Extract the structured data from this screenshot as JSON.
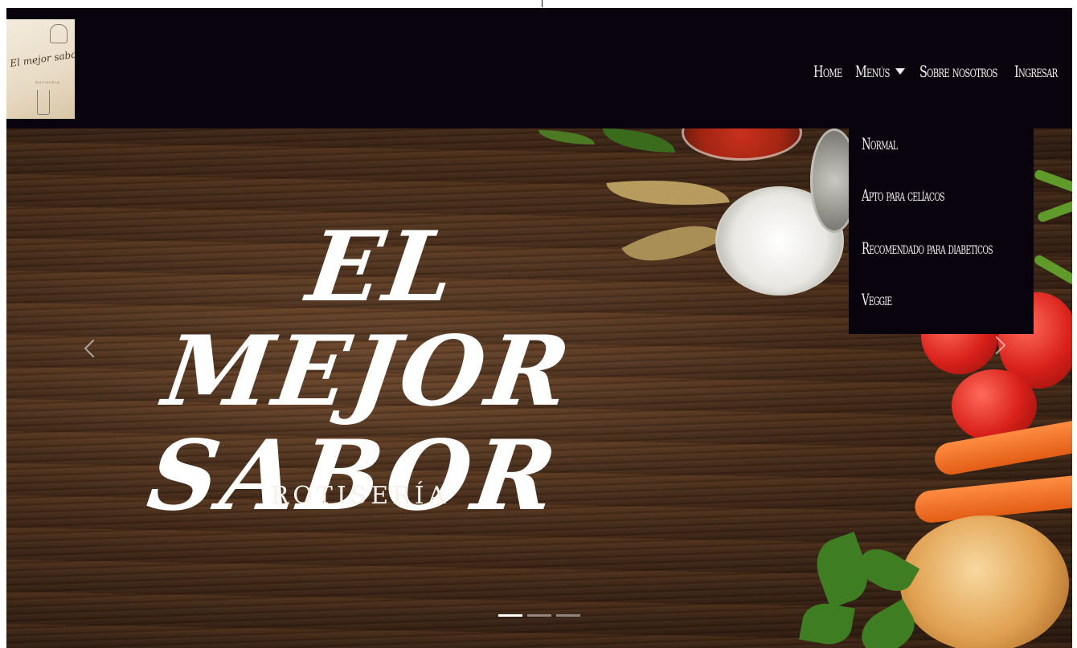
{
  "brand": {
    "logo_text": "El mejor sabor",
    "logo_subtext": "ROTISERIA"
  },
  "nav": {
    "home": "Home",
    "menus": "Menús",
    "about": "Sobre nosotros",
    "login": "Ingresar"
  },
  "dropdown": {
    "items": [
      "Normal",
      "Apto para celíacos",
      "Recomendado para diabeticos",
      "Veggie"
    ]
  },
  "hero": {
    "title_line1": "EL MEJOR",
    "title_line2": "SABOR",
    "subtitle": "ROTISERÍA",
    "slides_total": 3,
    "active_slide": 1
  },
  "icons": {
    "caret": "caret-down-icon",
    "prev": "chevron-left-icon",
    "next": "chevron-right-icon"
  },
  "colors": {
    "navbar_bg": "#09030e",
    "nav_text": "#f3f0ef"
  }
}
